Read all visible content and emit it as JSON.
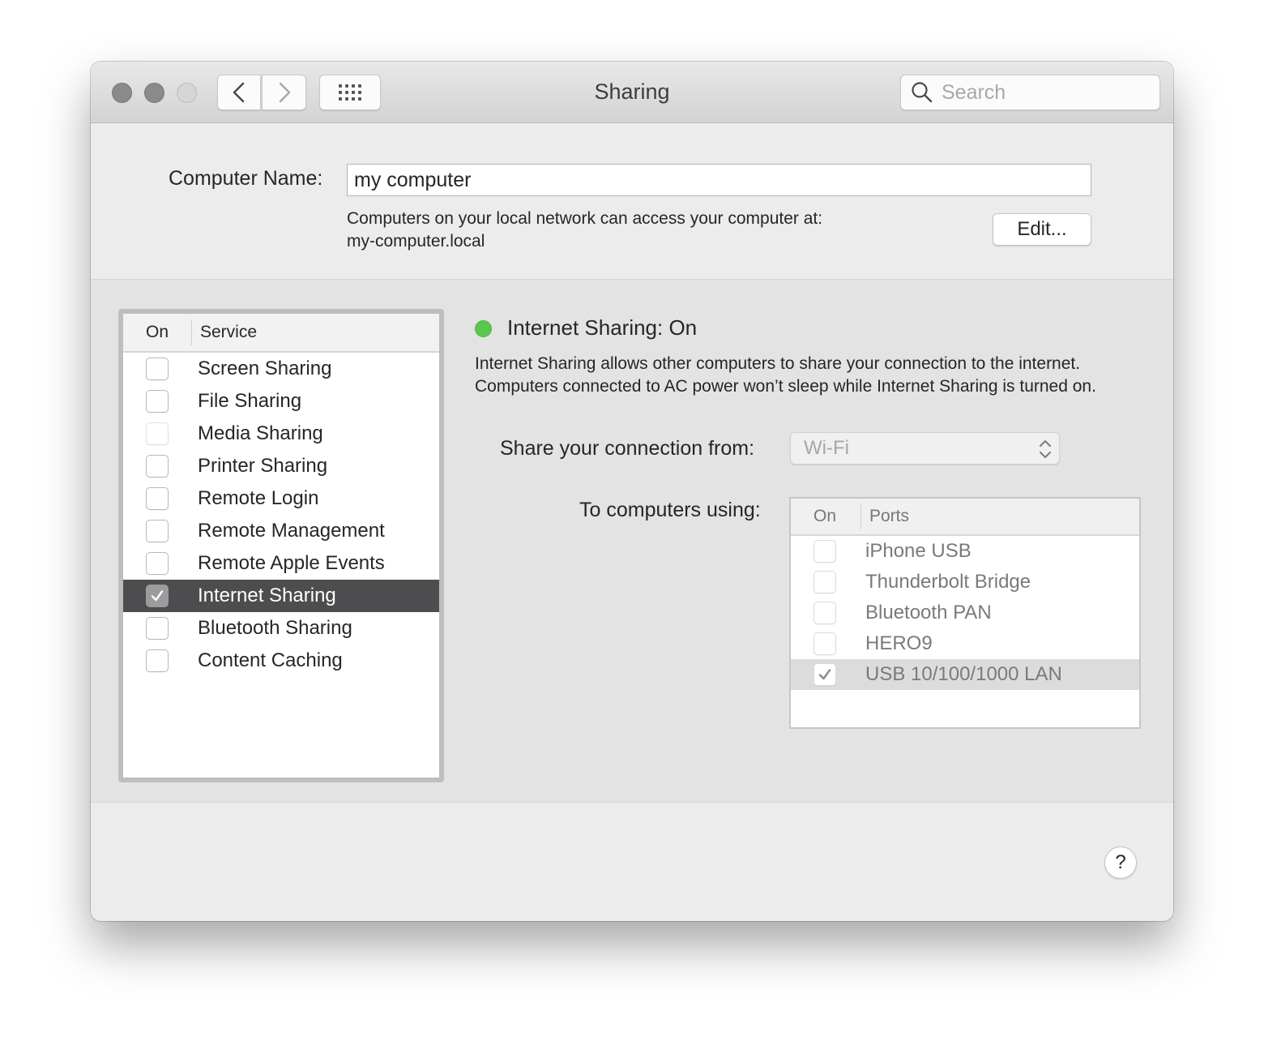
{
  "window": {
    "title": "Sharing",
    "search_placeholder": "Search"
  },
  "computer_name": {
    "label": "Computer Name:",
    "value": "my computer",
    "description_line1": "Computers on your local network can access your computer at:",
    "description_line2": "my-computer.local",
    "edit_label": "Edit..."
  },
  "services": {
    "header_on": "On",
    "header_service": "Service",
    "items": [
      {
        "label": "Screen Sharing",
        "checked": false,
        "enabled": true,
        "selected": false
      },
      {
        "label": "File Sharing",
        "checked": false,
        "enabled": true,
        "selected": false
      },
      {
        "label": "Media Sharing",
        "checked": false,
        "enabled": false,
        "selected": false
      },
      {
        "label": "Printer Sharing",
        "checked": false,
        "enabled": true,
        "selected": false
      },
      {
        "label": "Remote Login",
        "checked": false,
        "enabled": true,
        "selected": false
      },
      {
        "label": "Remote Management",
        "checked": false,
        "enabled": true,
        "selected": false
      },
      {
        "label": "Remote Apple Events",
        "checked": false,
        "enabled": true,
        "selected": false
      },
      {
        "label": "Internet Sharing",
        "checked": true,
        "enabled": true,
        "selected": true
      },
      {
        "label": "Bluetooth Sharing",
        "checked": false,
        "enabled": true,
        "selected": false
      },
      {
        "label": "Content Caching",
        "checked": false,
        "enabled": true,
        "selected": false
      }
    ]
  },
  "detail": {
    "status_text": "Internet Sharing: On",
    "status_color": "#5cc750",
    "description": "Internet Sharing allows other computers to share your connection to the internet. Computers connected to AC power won’t sleep while Internet Sharing is turned on.",
    "share_from_label": "Share your connection from:",
    "share_from_value": "Wi-Fi",
    "to_computers_label": "To computers using:",
    "ports_header_on": "On",
    "ports_header_ports": "Ports",
    "ports": [
      {
        "label": "iPhone USB",
        "checked": false,
        "highlighted": false
      },
      {
        "label": "Thunderbolt Bridge",
        "checked": false,
        "highlighted": false
      },
      {
        "label": "Bluetooth PAN",
        "checked": false,
        "highlighted": false
      },
      {
        "label": "HERO9",
        "checked": false,
        "highlighted": false
      },
      {
        "label": "USB 10/100/1000 LAN",
        "checked": true,
        "highlighted": true
      }
    ]
  },
  "help_label": "?"
}
